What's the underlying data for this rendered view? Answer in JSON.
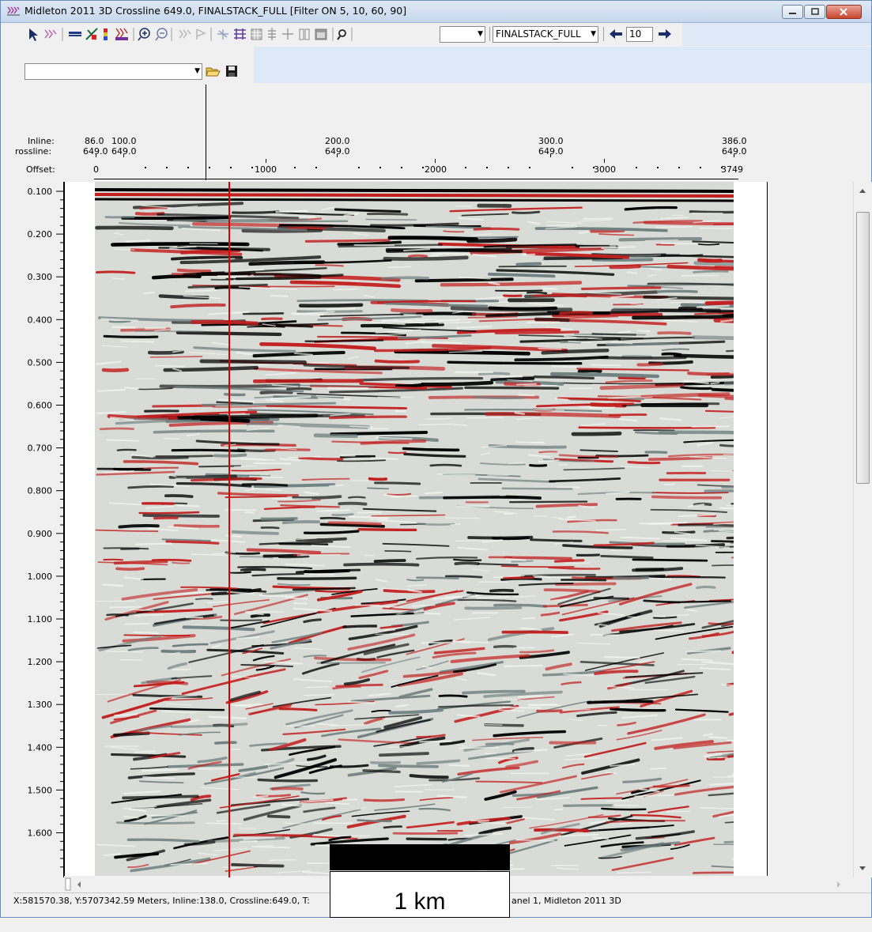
{
  "window": {
    "title": "Midleton 2011 3D Crossline 649.0, FINALSTACK_FULL [Filter ON 5, 10, 60, 90]"
  },
  "toolbar": {
    "stack_select": "FINALSTACK_FULL",
    "step_value": "10",
    "empty_combo": "",
    "file_combo": ""
  },
  "header": {
    "labels": {
      "inline": "Inline:",
      "crossline": "rossline:",
      "offset": "Offset:"
    },
    "columns": [
      {
        "inline": "86.0",
        "crossline": "649.0"
      },
      {
        "inline": "100.0",
        "crossline": "649.0"
      },
      {
        "inline": "200.0",
        "crossline": "649.0"
      },
      {
        "inline": "300.0",
        "crossline": "649.0"
      },
      {
        "inline": "386.0",
        "crossline": "649.0"
      }
    ],
    "offsets": [
      "0",
      "1000",
      "2000",
      "3000",
      "3749"
    ]
  },
  "time_axis": {
    "labels": [
      "0.100",
      "0.200",
      "0.300",
      "0.400",
      "0.500",
      "0.600",
      "0.700",
      "0.800",
      "0.900",
      "1.000",
      "1.100",
      "1.200",
      "1.300",
      "1.400",
      "1.500",
      "1.600"
    ]
  },
  "status": {
    "left": "X:581570.38, Y:5707342.59 Meters,   Inline:138.0,  Crossline:649.0,   T:",
    "right": "anel 1,  Midleton 2011 3D"
  },
  "scale_bar": {
    "label": "1 km"
  },
  "colors": {
    "peak": "#c21f1f",
    "trough": "#000000",
    "marker": "#e00000"
  },
  "icons": [
    "pointer-icon",
    "zigzag-icon",
    "horizon-icon",
    "fault-icon",
    "colorbar-icon",
    "wiggle-icon",
    "zoom-in-icon",
    "zoom-out-icon",
    "open-folder-icon",
    "save-icon",
    "left-arrow-icon",
    "right-arrow-icon"
  ]
}
